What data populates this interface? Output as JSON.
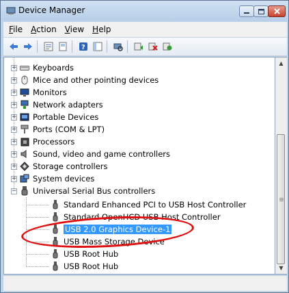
{
  "window": {
    "title": "Device Manager"
  },
  "menu": [
    {
      "label_ul": "F",
      "label_rest": "ile"
    },
    {
      "label_ul": "A",
      "label_rest": "ction"
    },
    {
      "label_ul": "V",
      "label_rest": "iew"
    },
    {
      "label_ul": "H",
      "label_rest": "elp"
    }
  ],
  "toolbar": {
    "icons": [
      "back-arrow-icon",
      "forward-arrow-icon",
      "properties-icon",
      "show-hidden-icon",
      "help-icon",
      "console-tree-icon",
      "scan-hardware-icon",
      "update-driver-icon",
      "disable-device-icon",
      "uninstall-device-icon"
    ]
  },
  "tree": {
    "categories": [
      {
        "label": "Keyboards",
        "icon": "keyboard-icon"
      },
      {
        "label": "Mice and other pointing devices",
        "icon": "mouse-icon"
      },
      {
        "label": "Monitors",
        "icon": "monitor-icon"
      },
      {
        "label": "Network adapters",
        "icon": "network-adapter-icon"
      },
      {
        "label": "Portable Devices",
        "icon": "portable-device-icon"
      },
      {
        "label": "Ports (COM & LPT)",
        "icon": "port-icon"
      },
      {
        "label": "Processors",
        "icon": "processor-icon"
      },
      {
        "label": "Sound, video and game controllers",
        "icon": "speaker-icon"
      },
      {
        "label": "Storage controllers",
        "icon": "storage-controller-icon"
      },
      {
        "label": "System devices",
        "icon": "system-device-icon"
      },
      {
        "label": "Universal Serial Bus controllers",
        "icon": "usb-icon"
      }
    ],
    "usb_children": [
      {
        "label": "Standard Enhanced PCI to USB Host Controller"
      },
      {
        "label": "Standard OpenHCD USB Host Controller"
      },
      {
        "label": "USB 2.0 Graphics Device-1",
        "selected": true
      },
      {
        "label": "USB Mass Storage Device"
      },
      {
        "label": "USB Root Hub"
      },
      {
        "label": "USB Root Hub"
      }
    ],
    "selected_color": "#3399ff"
  },
  "annotation": {
    "color": "#e01010",
    "shape": "ellipse",
    "target": "USB 2.0 Graphics Device-1"
  }
}
